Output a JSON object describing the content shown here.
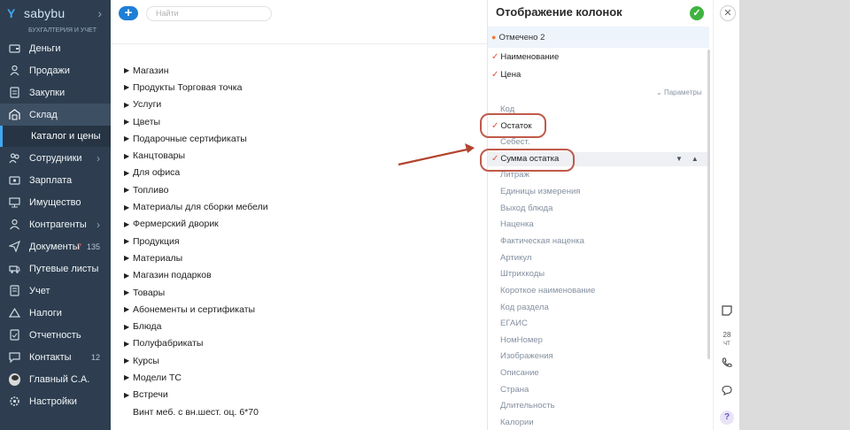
{
  "sidebar": {
    "brand": "sabybu",
    "subbrand": "БУХГАЛТЕРИЯ И УЧЕТ",
    "items": [
      {
        "label": "Деньги",
        "icon": "wallet-icon"
      },
      {
        "label": "Продажи",
        "icon": "sales-icon"
      },
      {
        "label": "Закупки",
        "icon": "purchases-icon"
      },
      {
        "label": "Склад",
        "icon": "warehouse-icon"
      },
      {
        "label": "Каталог и цены",
        "icon": ""
      },
      {
        "label": "Сотрудники",
        "icon": "employees-icon"
      },
      {
        "label": "Зарплата",
        "icon": "salary-icon"
      },
      {
        "label": "Имущество",
        "icon": "property-icon"
      },
      {
        "label": "Контрагенты",
        "icon": "counterparties-icon"
      },
      {
        "label": "Документы",
        "icon": "documents-icon",
        "badge_red": "7",
        "badge": "135"
      },
      {
        "label": "Путевые листы",
        "icon": "waybills-icon"
      },
      {
        "label": "Учет",
        "icon": "accounting-icon"
      },
      {
        "label": "Налоги",
        "icon": "taxes-icon"
      },
      {
        "label": "Отчетность",
        "icon": "reports-icon"
      },
      {
        "label": "Контакты",
        "icon": "contacts-icon",
        "badge": "12"
      },
      {
        "label": "Главный С.А.",
        "icon": "avatar"
      },
      {
        "label": "Настройки",
        "icon": "settings-icon"
      }
    ]
  },
  "topbar": {
    "plus": "+",
    "search_placeholder": "Найти"
  },
  "folders": [
    "Магазин",
    "Продукты Торговая точка",
    "Услуги",
    "Цветы",
    "Подарочные сертификаты",
    "Канцтовары",
    "Для офиса",
    "Топливо",
    "Материалы для сборки мебели",
    "Фермерский дворик",
    "Продукция",
    "Материалы",
    "Магазин подарков",
    "Товары",
    "Абонементы и сертификаты",
    "Блюда",
    "Полуфабрикаты",
    "Курсы",
    "Модели ТС",
    "Встречи"
  ],
  "folder_plain": "Винт меб. с вн.шест. оц. 6*70",
  "panel": {
    "title": "Отображение колонок",
    "selected": "Отмечено 2",
    "params": "Параметры",
    "checked": [
      "Наименование",
      "Цена"
    ],
    "columns": [
      {
        "label": "Код",
        "checked": false
      },
      {
        "label": "Остаток",
        "checked": true
      },
      {
        "label": "Себест.",
        "checked": false
      },
      {
        "label": "Сумма остатка",
        "checked": true
      },
      {
        "label": "Литраж",
        "checked": false
      },
      {
        "label": "Единицы измерения",
        "checked": false
      },
      {
        "label": "Выход блюда",
        "checked": false
      },
      {
        "label": "Наценка",
        "checked": false
      },
      {
        "label": "Фактическая наценка",
        "checked": false
      },
      {
        "label": "Артикул",
        "checked": false
      },
      {
        "label": "Штрихкоды",
        "checked": false
      },
      {
        "label": "Короткое наименование",
        "checked": false
      },
      {
        "label": "Код раздела",
        "checked": false
      },
      {
        "label": "ЕГАИС",
        "checked": false
      },
      {
        "label": "НомНомер",
        "checked": false
      },
      {
        "label": "Изображения",
        "checked": false
      },
      {
        "label": "Описание",
        "checked": false
      },
      {
        "label": "Страна",
        "checked": false
      },
      {
        "label": "Длительность",
        "checked": false
      },
      {
        "label": "Калории",
        "checked": false
      }
    ]
  },
  "rail": {
    "calendar_day": "28",
    "calendar_sub": "ЧТ",
    "help": "?"
  },
  "colors": {
    "sidebar": "#2e3e50",
    "accent": "#1e7fd6",
    "ok": "#3eb340",
    "highlight": "#c05a4a"
  }
}
